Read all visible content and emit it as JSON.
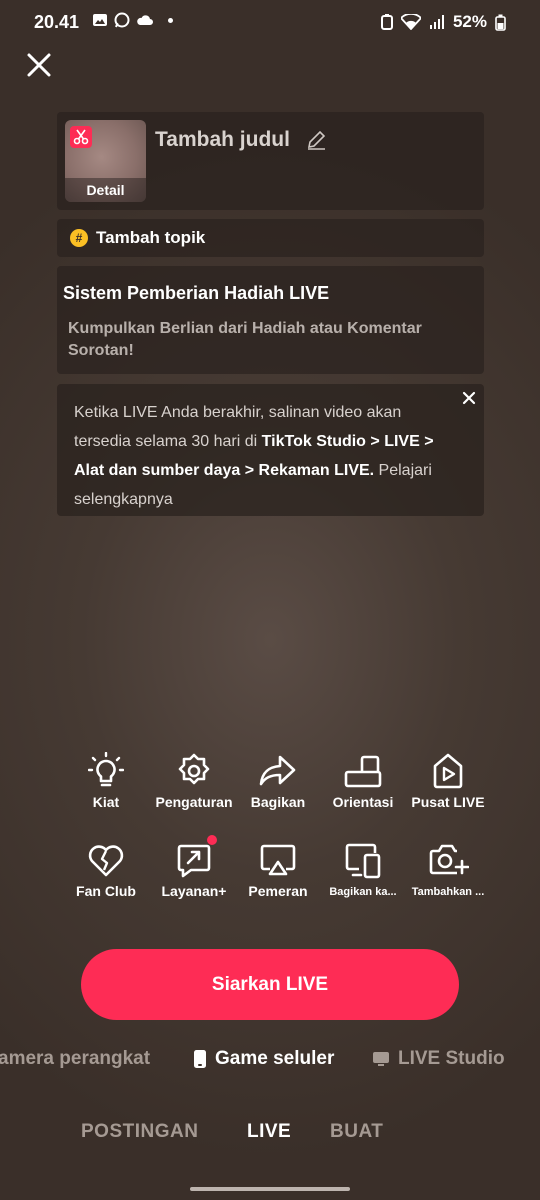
{
  "status_bar": {
    "time": "20.41",
    "battery": "52%"
  },
  "title_card": {
    "thumbnail_label": "Detail",
    "title_placeholder": "Tambah judul"
  },
  "topic": {
    "icon_symbol": "#",
    "label": "Tambah topik"
  },
  "gift_card": {
    "title": "Sistem Pemberian Hadiah LIVE",
    "description": "Kumpulkan Berlian dari Hadiah atau Komentar Sorotan!"
  },
  "info_card": {
    "text_1": "Ketika LIVE Anda berakhir, salinan video akan tersedia selama 30 hari di ",
    "text_bold": "TikTok Studio > LIVE > Alat dan sumber daya > Rekaman LIVE.",
    "text_2": " Pelajari selengkapnya"
  },
  "tools": [
    {
      "label": "Kiat",
      "icon": "lightbulb-icon"
    },
    {
      "label": "Pengaturan",
      "icon": "gear-icon"
    },
    {
      "label": "Bagikan",
      "icon": "share-arrow-icon"
    },
    {
      "label": "Orientasi",
      "icon": "orientation-icon"
    },
    {
      "label": "Pusat LIVE",
      "icon": "live-center-icon"
    },
    {
      "label": "Fan Club",
      "icon": "heart-icon"
    },
    {
      "label": "Layanan+",
      "icon": "services-icon"
    },
    {
      "label": "Pemeran",
      "icon": "cast-icon"
    },
    {
      "label": "Bagikan ka...",
      "icon": "share-screen-icon"
    },
    {
      "label": "Tambahkan ...",
      "icon": "add-camera-icon"
    }
  ],
  "go_live_label": "Siarkan LIVE",
  "modes": [
    {
      "label": "amera perangkat",
      "icon": "",
      "active": false
    },
    {
      "label": "Game seluler",
      "icon": "phone-icon",
      "active": true
    },
    {
      "label": "LIVE Studio",
      "icon": "monitor-icon",
      "active": false
    }
  ],
  "tabs": [
    {
      "label": "POSTINGAN",
      "active": false
    },
    {
      "label": "LIVE",
      "active": true
    },
    {
      "label": "BUAT",
      "active": false
    }
  ],
  "colors": {
    "accent": "#fe2c55",
    "background": "#3a2f29",
    "hashtag": "#fbbf24"
  }
}
